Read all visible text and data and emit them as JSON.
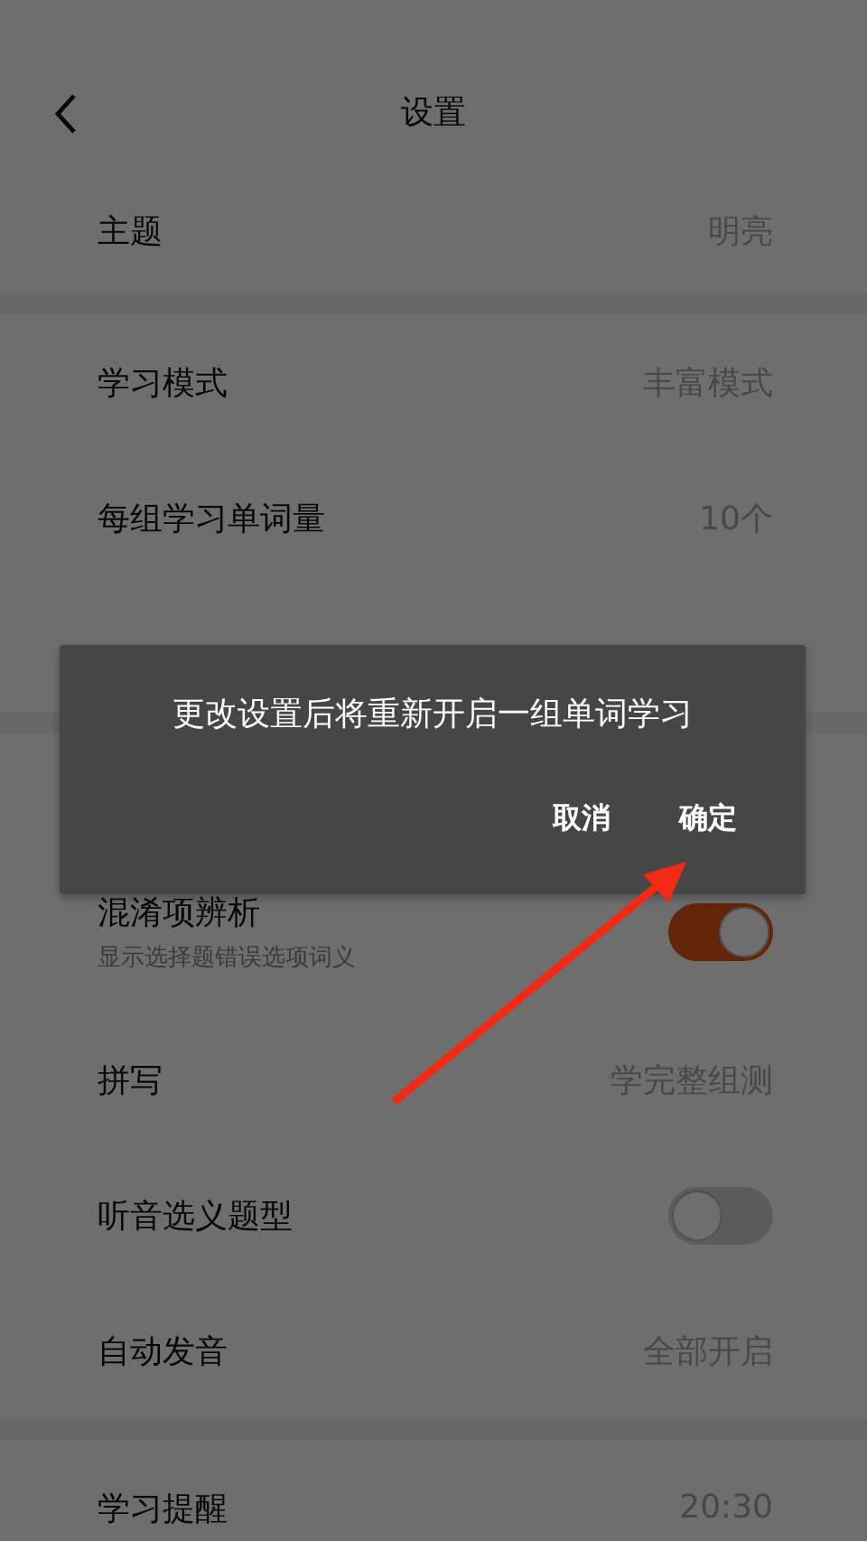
{
  "header": {
    "title": "设置"
  },
  "sections": [
    {
      "rows": [
        {
          "kind": "value",
          "label": "主题",
          "value": "明亮"
        }
      ]
    },
    {
      "rows": [
        {
          "kind": "value",
          "label": "学习模式",
          "value": "丰富模式"
        },
        {
          "kind": "value",
          "label": "每组学习单词量",
          "value": "10个"
        }
      ]
    },
    {
      "rows": [
        {
          "kind": "toggle",
          "label": "混淆项辨析",
          "subtitle": "显示选择题错误选项词义",
          "on": true
        },
        {
          "kind": "value",
          "label": "拼写",
          "value": "学完整组测"
        },
        {
          "kind": "toggle",
          "label": "听音选义题型",
          "on": false
        },
        {
          "kind": "value",
          "label": "自动发音",
          "value": "全部开启"
        }
      ]
    },
    {
      "rows": [
        {
          "kind": "value",
          "label": "学习提醒",
          "value": "20:30"
        }
      ]
    }
  ],
  "dialog": {
    "message": "更改设置后将重新开启一组单词学习",
    "buttons": [
      "取消",
      "确定"
    ]
  }
}
